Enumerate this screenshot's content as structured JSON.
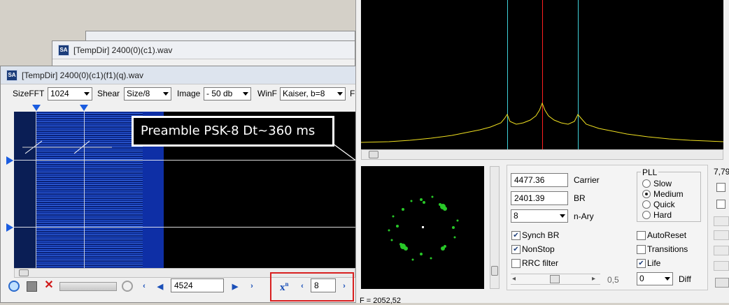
{
  "windows": {
    "back_title": "[TempDir] 2400(0)(c1).wav",
    "front_title": "[TempDir] 2400(0)(c1)(f1)(q).wav",
    "app_icon": "SA"
  },
  "toolbar": {
    "sizefft_label": "SizeFFT",
    "sizefft_value": "1024",
    "shear_label": "Shear",
    "shear_value": "Size/8",
    "image_label": "Image",
    "image_value": "- 50 db",
    "winf_label": "WinF",
    "winf_value": "Kaiser, b=8",
    "f_label": "F"
  },
  "annotation": "Preamble PSK-8 Dt~360 ms",
  "bottom_bar": {
    "position_value": "4524",
    "power_symbol": "x",
    "power_exp": "n",
    "power_value": "8"
  },
  "demod": {
    "carrier_value": "4477.36",
    "carrier_label": "Carrier",
    "br_value": "2401.39",
    "br_label": "BR",
    "nary_value": "8",
    "nary_label": "n-Ary",
    "pll_title": "PLL",
    "pll_options": [
      "Slow",
      "Medium",
      "Quick",
      "Hard"
    ],
    "pll_selected": "Medium",
    "synch_br": "Synch BR",
    "nonstop": "NonStop",
    "rrc_filter": "RRC filter",
    "autoreset": "AutoReset",
    "transitions": "Transitions",
    "life": "Life",
    "slider_value": "0,5",
    "diff_value": "0",
    "diff_label": "Diff",
    "partial_value": "7,79"
  },
  "status": {
    "freq_text": "F = 2052,52"
  },
  "colors": {
    "carrier_marker": "#ff2020",
    "side_markers": "#3fd0d8",
    "spectrum_trace": "#f0e020",
    "constellation": "#28c828",
    "highlight_box": "#d82020",
    "waterfall": "#1a4bd8"
  }
}
